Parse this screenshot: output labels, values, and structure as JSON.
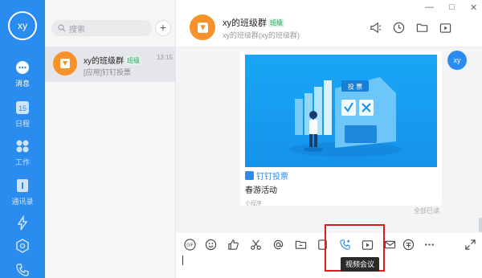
{
  "rail": {
    "avatar": "xy",
    "items": [
      {
        "label": "消息",
        "icon": "chat-icon"
      },
      {
        "label": "日程",
        "icon": "calendar-icon",
        "badge": "15"
      },
      {
        "label": "工作",
        "icon": "grid-icon"
      },
      {
        "label": "通讯录",
        "icon": "contacts-icon"
      }
    ]
  },
  "list": {
    "search_placeholder": "搜索",
    "conversation": {
      "name": "xy的班级群",
      "tag": "班级",
      "time": "13:15",
      "preview": "[应用]钉钉投票"
    }
  },
  "header": {
    "title": "xy的班级群",
    "tag": "班级",
    "subtitle": "xy的班级群(xy的班级群)"
  },
  "window": {
    "min": "—",
    "max": "□",
    "close": "✕"
  },
  "message": {
    "me_avatar": "xy",
    "banner_text": "投 票",
    "app_name": "钉钉投票",
    "card_title": "春游活动",
    "mini_label": "小程序",
    "read_status": "全部已读"
  },
  "toolbar": {
    "gif": "GIF",
    "tooltip": "视频会议"
  },
  "colors": {
    "accent": "#2b8cef",
    "group_avatar": "#f7922a",
    "highlight": "#d81e1e"
  }
}
